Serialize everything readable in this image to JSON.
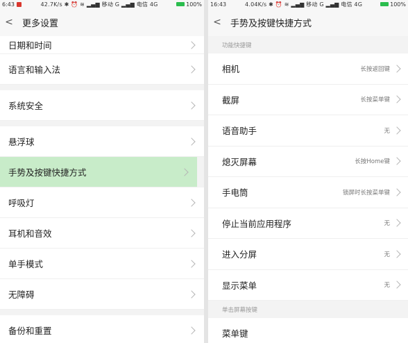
{
  "left": {
    "status": {
      "time": "6:43",
      "speed": "42.7K/s",
      "carrier1": "移动 G",
      "carrier2": "电信 4G",
      "battery": "100%"
    },
    "title": "更多设置",
    "items": [
      {
        "label": "日期和时间"
      },
      {
        "label": "语言和输入法"
      },
      {
        "label": "系统安全"
      },
      {
        "label": "悬浮球"
      },
      {
        "label": "手势及按键快捷方式"
      },
      {
        "label": "呼吸灯"
      },
      {
        "label": "耳机和音效"
      },
      {
        "label": "单手模式"
      },
      {
        "label": "无障碍"
      },
      {
        "label": "备份和重置"
      }
    ]
  },
  "right": {
    "status": {
      "time": "16:43",
      "speed": "4.04K/s",
      "carrier1": "移动 G",
      "carrier2": "电信 4G",
      "battery": "100%"
    },
    "title": "手势及按键快捷方式",
    "section1": "功能快捷键",
    "items": [
      {
        "label": "相机",
        "value": "长按返回键"
      },
      {
        "label": "截屏",
        "value": "长按菜单键"
      },
      {
        "label": "语音助手",
        "value": "无"
      },
      {
        "label": "熄灭屏幕",
        "value": "长按Home键"
      },
      {
        "label": "手电筒",
        "value": "锁屏时长按菜单键"
      },
      {
        "label": "停止当前应用程序",
        "value": "无"
      },
      {
        "label": "进入分屏",
        "value": "无"
      },
      {
        "label": "显示菜单",
        "value": "无"
      }
    ],
    "section2": "单击屏幕按键",
    "items2": [
      {
        "label": "菜单键"
      }
    ]
  },
  "colors": {
    "selected": "#c8ecc9",
    "battery": "#2bbd4e",
    "notification": "#d9372e"
  }
}
